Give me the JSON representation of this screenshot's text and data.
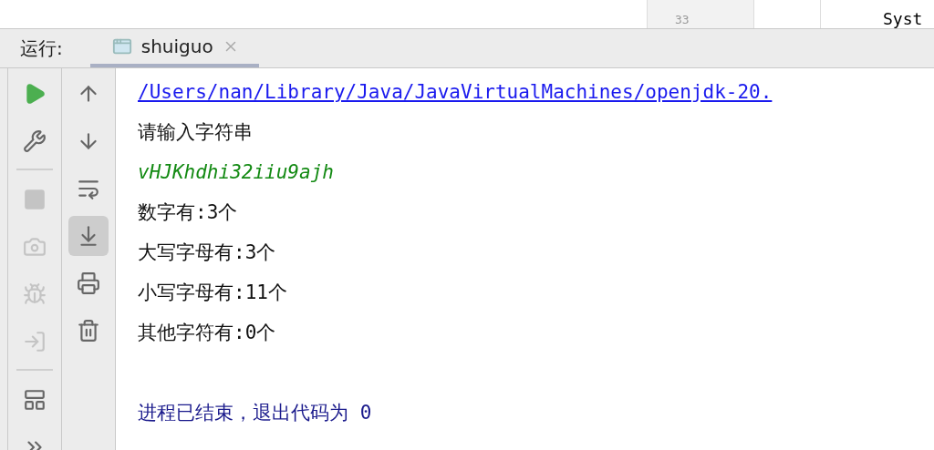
{
  "editor": {
    "line_number": "33",
    "code": "Syst"
  },
  "run_panel": {
    "label": "运行:",
    "tabs": [
      {
        "label": "shuiguo",
        "selected": true
      }
    ]
  },
  "left_toolbar": [
    {
      "kind": "run",
      "disabled": false
    },
    {
      "kind": "settings",
      "disabled": false
    },
    {
      "kind": "separator"
    },
    {
      "kind": "stop",
      "disabled": true
    },
    {
      "kind": "camera",
      "disabled": true
    },
    {
      "kind": "debug",
      "disabled": true
    },
    {
      "kind": "login",
      "disabled": true
    },
    {
      "kind": "separator"
    },
    {
      "kind": "layout",
      "disabled": false
    },
    {
      "kind": "more",
      "disabled": false
    }
  ],
  "right_toolbar": [
    {
      "kind": "up",
      "selected": false
    },
    {
      "kind": "down",
      "selected": false
    },
    {
      "kind": "wrap",
      "selected": false
    },
    {
      "kind": "scroll-end",
      "selected": true
    },
    {
      "kind": "print",
      "selected": false
    },
    {
      "kind": "delete",
      "selected": false
    }
  ],
  "console": [
    {
      "kind": "link",
      "text": "/Users/nan/Library/Java/JavaVirtualMachines/openjdk-20."
    },
    {
      "kind": "output",
      "text": "请输入字符串"
    },
    {
      "kind": "input",
      "text": "vHJKhdhi32iiu9ajh"
    },
    {
      "kind": "output",
      "text": "数字有:3个"
    },
    {
      "kind": "output",
      "text": "大写字母有:3个"
    },
    {
      "kind": "output",
      "text": "小写字母有:11个"
    },
    {
      "kind": "output",
      "text": "其他字符有:0个"
    },
    {
      "kind": "exit",
      "text": "进程已结束，退出代码为 0"
    }
  ]
}
